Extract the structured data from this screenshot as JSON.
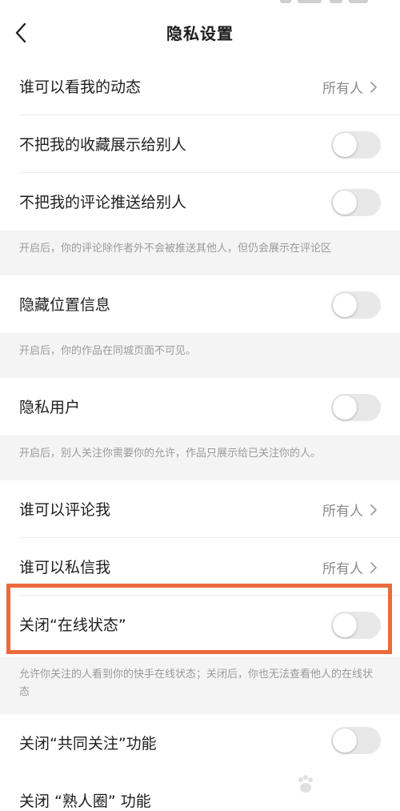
{
  "header": {
    "title": "隐私设置"
  },
  "settings": {
    "who_can_see_dynamic": {
      "label": "谁可以看我的动态",
      "value": "所有人"
    },
    "hide_favorites": {
      "label": "不把我的收藏展示给别人",
      "on": false
    },
    "hide_comments": {
      "label": "不把我的评论推送给别人",
      "on": false
    },
    "hide_comments_note": "开启后，你的评论除作者外不会被推送其他人，但仍会展示在评论区",
    "hide_location": {
      "label": "隐藏位置信息",
      "on": false
    },
    "hide_location_note": "开启后，你的作品在同城页面不可见。",
    "private_user": {
      "label": "隐私用户",
      "on": false
    },
    "private_user_note": "开启后，别人关注你需要你的允许，作品只展示给已关注你的人。",
    "who_can_comment": {
      "label": "谁可以评论我",
      "value": "所有人"
    },
    "who_can_message": {
      "label": "谁可以私信我",
      "value": "所有人"
    },
    "close_online_status": {
      "label": "关闭“在线状态”",
      "on": false
    },
    "close_online_status_note": "允许你关注的人看到你的快手在线状态；关闭后，你也无法查看他人的在线状态",
    "close_mutual_follow": {
      "label": "关闭“共同关注”功能",
      "on": false
    },
    "close_acquaintance": {
      "label": "关闭 “熟人圈” 功能"
    }
  },
  "colors": {
    "highlight": "#ec6a3c",
    "toggle_off": "#e8e8e8",
    "note_bg": "#f4f4f4"
  },
  "icons": {
    "back": "chevron-left-icon",
    "arrow": "chevron-right-icon"
  }
}
